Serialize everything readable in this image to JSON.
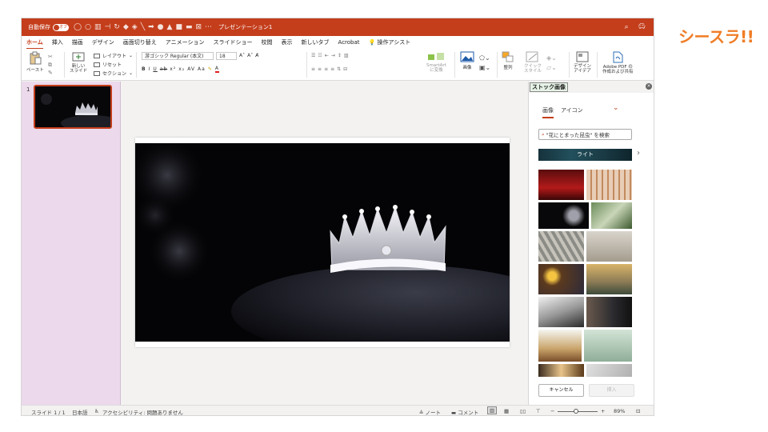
{
  "brand": {
    "logo_text": "シースラ!!"
  },
  "titlebar": {
    "autosave_label": "自動保存",
    "autosave_state": "オフ",
    "doc_title": "プレゼンテーション1"
  },
  "ribbon_tabs": [
    "ホーム",
    "挿入",
    "描画",
    "デザイン",
    "画面切り替え",
    "アニメーション",
    "スライドショー",
    "校閲",
    "表示",
    "新しいタブ",
    "Acrobat"
  ],
  "tell_me": "操作アシスト",
  "share_label": "共有",
  "comment_label": "コメント",
  "ribbon": {
    "paste": "ペースト",
    "new_slide": "新しい\nスライド",
    "layout": "レイアウト",
    "reset": "リセット",
    "section": "セクション",
    "font_name": "游ゴシック Regular (本文)",
    "font_size": "18",
    "convert_smartart": "SmartArt\nに変換",
    "picture": "画像",
    "arrange": "整列",
    "quick_styles": "クイック\nスタイル",
    "design_ideas": "デザイン\nアイデア",
    "adobe_pdf": "Adobe PDF の\n作成および共有"
  },
  "slides": [
    {
      "number": "1"
    }
  ],
  "stock_pane": {
    "title": "ストック画像",
    "tabs": [
      "画像",
      "アイコン"
    ],
    "search_placeholder": "\"花にとまった昆虫\" を検索",
    "category": "ライト",
    "cancel_label": "キャンセル",
    "insert_label": "挿入"
  },
  "statusbar": {
    "slide_info": "スライド 1 / 1",
    "language": "日本語",
    "accessibility": "アクセシビリティ: 問題ありません",
    "notes": "ノート",
    "comments": "コメント",
    "zoom": "89%"
  },
  "colors": {
    "accent": "#c43e1c",
    "pane_bg": "#ecd9ec"
  }
}
